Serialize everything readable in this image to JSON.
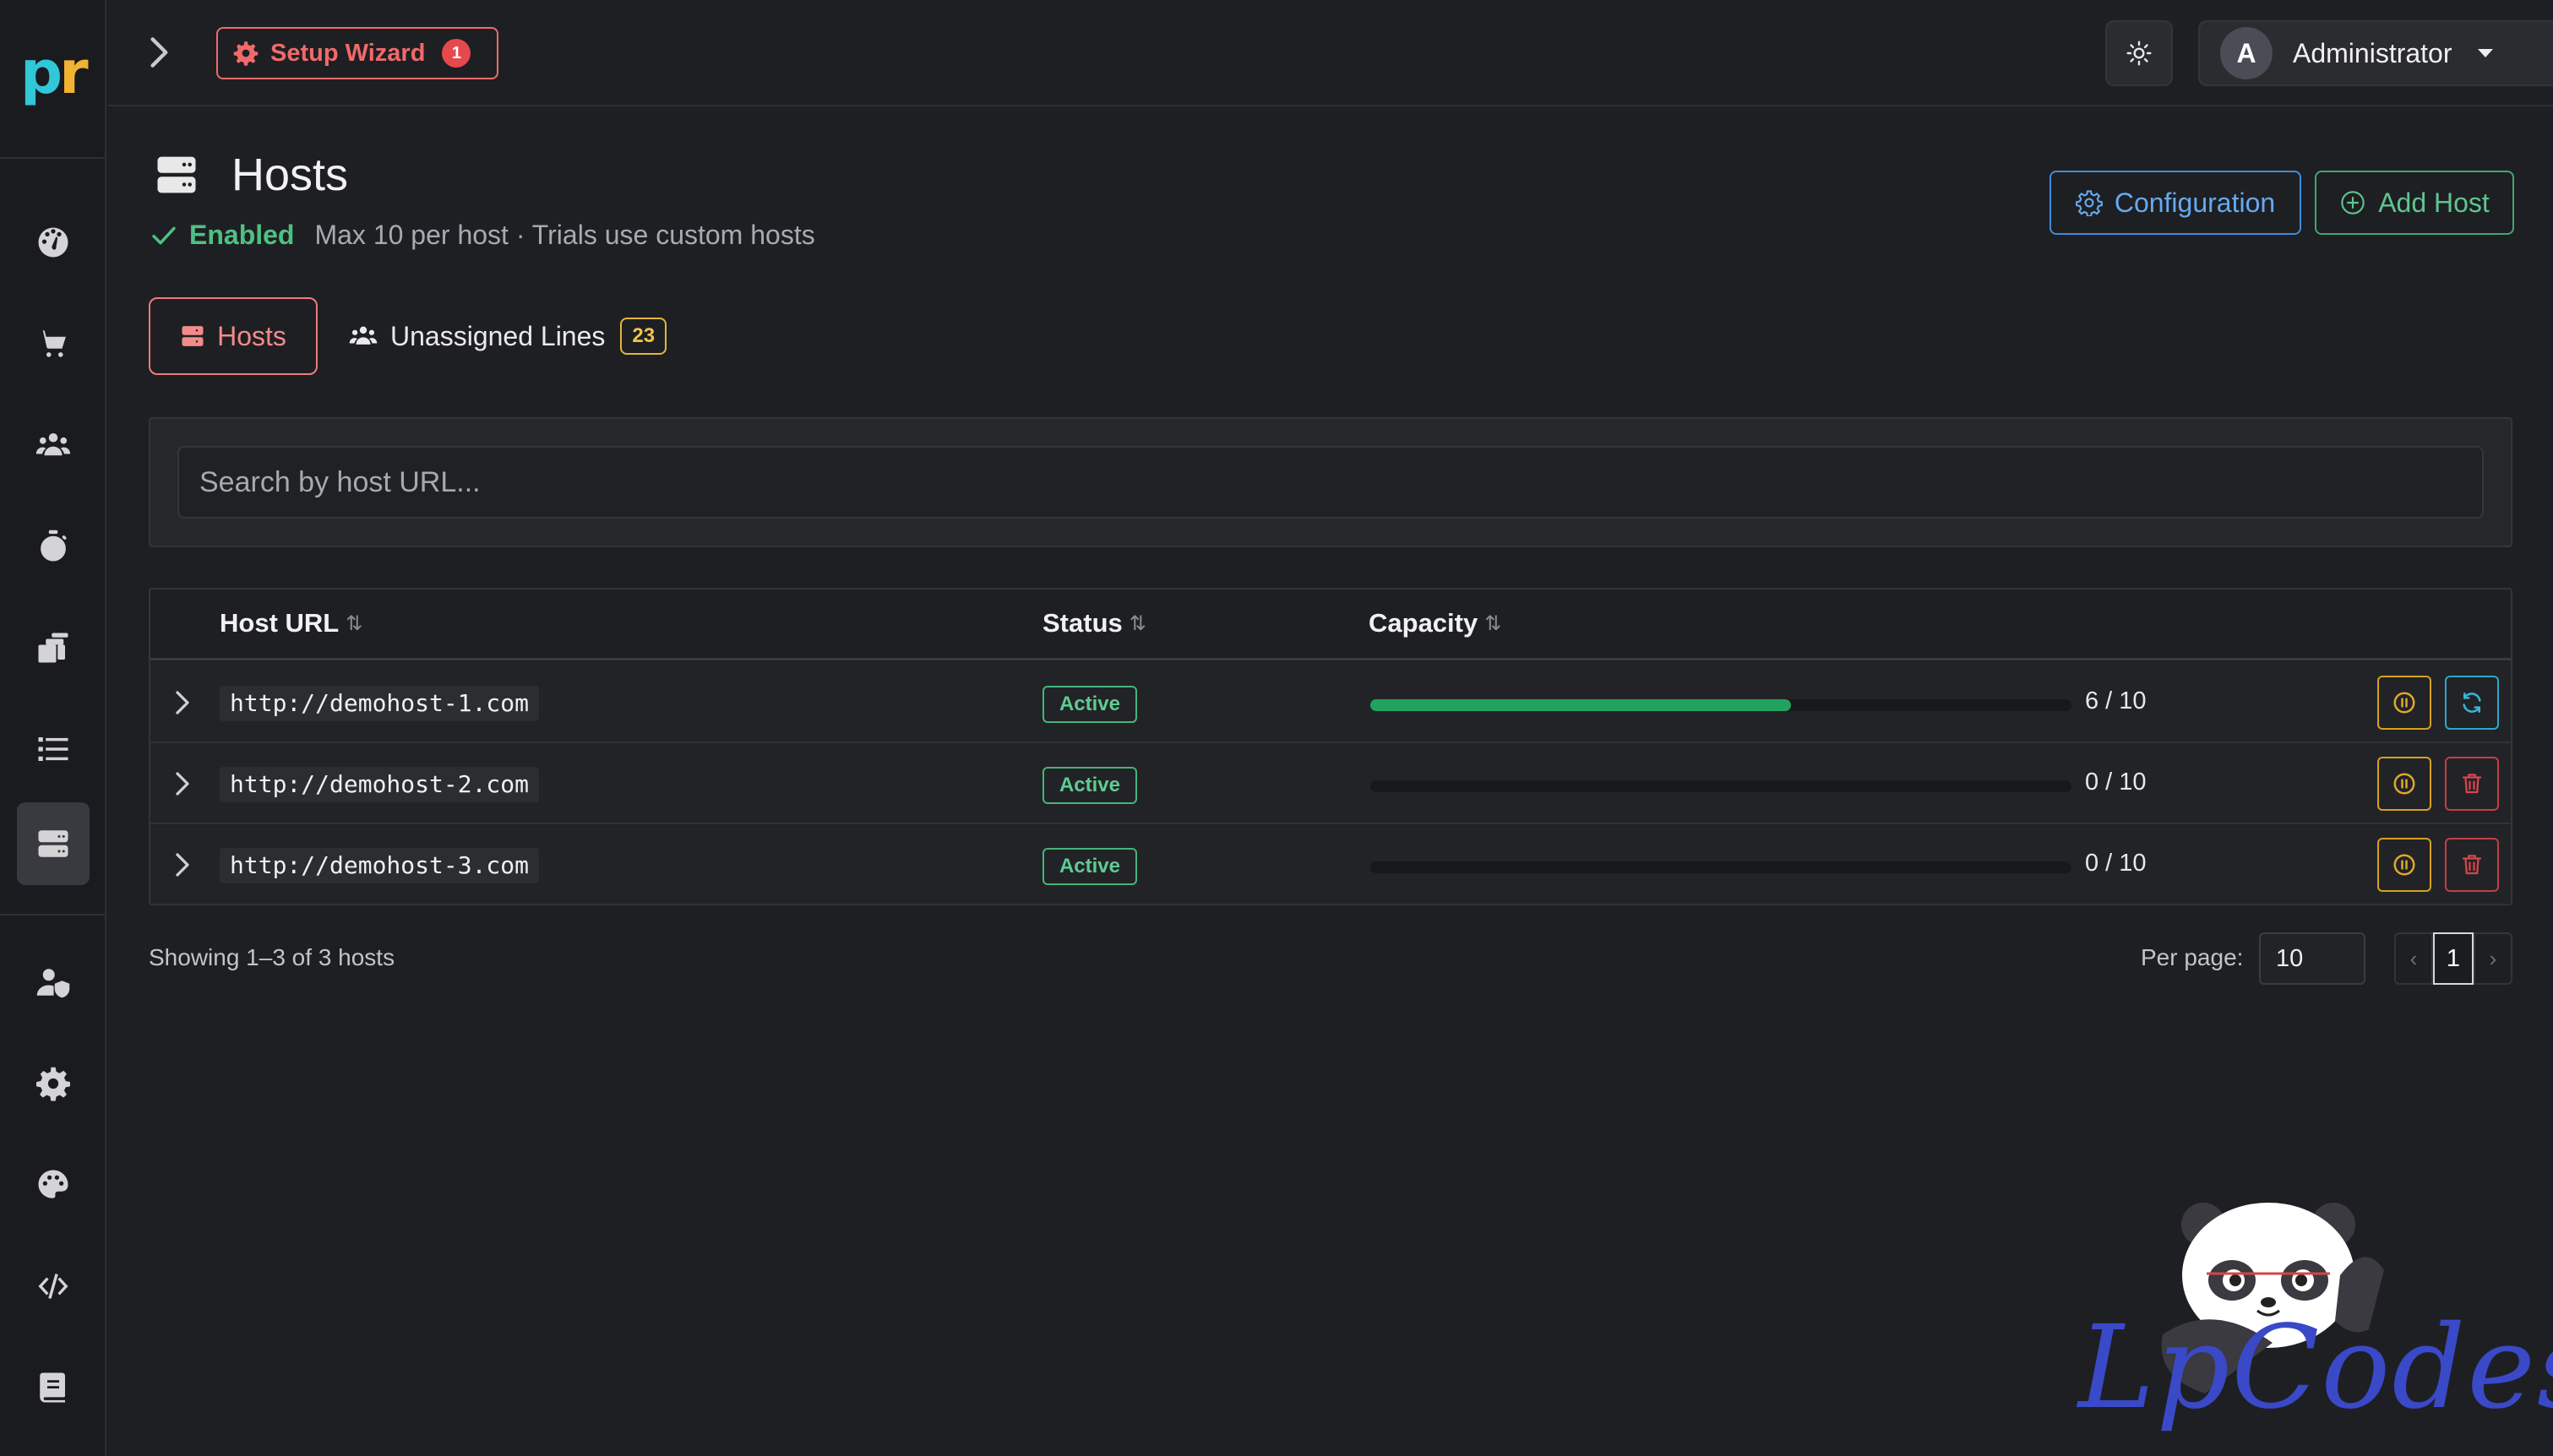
{
  "brand": {
    "logo_text_p": "p",
    "logo_text_r": "r"
  },
  "sidebar": {
    "items": [
      {
        "name": "dashboard",
        "icon": "palette-gauge-icon"
      },
      {
        "name": "shop",
        "icon": "cart-icon"
      },
      {
        "name": "users",
        "icon": "users-icon"
      },
      {
        "name": "timers",
        "icon": "stopwatch-icon"
      },
      {
        "name": "reports",
        "icon": "stack-icon"
      },
      {
        "name": "lists",
        "icon": "list-icon"
      },
      {
        "name": "hosts",
        "icon": "server-icon",
        "active": true
      },
      {
        "name": "admin-users",
        "icon": "user-shield-icon"
      },
      {
        "name": "settings",
        "icon": "gear-icon"
      },
      {
        "name": "themes",
        "icon": "palette-icon"
      },
      {
        "name": "developer",
        "icon": "code-icon"
      },
      {
        "name": "docs",
        "icon": "book-icon"
      }
    ]
  },
  "topbar": {
    "setup_label": "Setup Wizard",
    "setup_count": "1",
    "user_initial": "A",
    "user_name": "Administrator"
  },
  "header": {
    "title": "Hosts",
    "enabled_label": "Enabled",
    "meta": "Max 10 per host · Trials use custom hosts",
    "config_label": "Configuration",
    "add_label": "Add Host"
  },
  "tabs": {
    "hosts_label": "Hosts",
    "unassigned_label": "Unassigned Lines",
    "unassigned_count": "23"
  },
  "search": {
    "placeholder": "Search by host URL..."
  },
  "table": {
    "headers": {
      "url": "Host URL",
      "status": "Status",
      "capacity": "Capacity"
    },
    "rows": [
      {
        "url": "http://demohost-1.com",
        "status": "Active",
        "used": 6,
        "max": 10,
        "capacity_text": "6 / 10",
        "secondary_action": "refresh"
      },
      {
        "url": "http://demohost-2.com",
        "status": "Active",
        "used": 0,
        "max": 10,
        "capacity_text": "0 / 10",
        "secondary_action": "delete"
      },
      {
        "url": "http://demohost-3.com",
        "status": "Active",
        "used": 0,
        "max": 10,
        "capacity_text": "0 / 10",
        "secondary_action": "delete"
      }
    ]
  },
  "footer": {
    "showing": "Showing 1–3 of 3 hosts",
    "per_page_label": "Per page:",
    "per_page_value": "10",
    "prev": "‹",
    "page": "1",
    "next": "›"
  },
  "watermark": {
    "text": "LpCodes"
  },
  "colors": {
    "accent_red": "#f06a6a",
    "accent_green": "#21a35f",
    "accent_blue": "#3d8ddc",
    "accent_yellow": "#e4b63b"
  }
}
